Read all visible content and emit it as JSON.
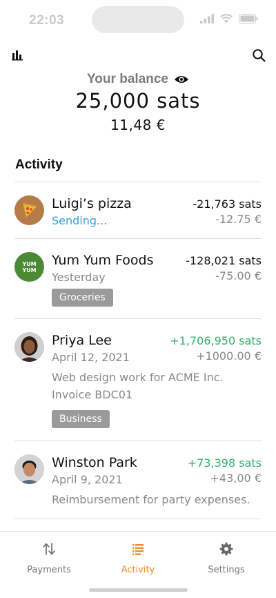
{
  "status_bar": {
    "time": "22:03"
  },
  "balance": {
    "label": "Your balance",
    "sats": "25,000 sats",
    "fiat": "11,48 €"
  },
  "activity": {
    "title": "Activity",
    "items": [
      {
        "name": "Luigi’s pizza",
        "subtitle": "Sending...",
        "sats": "-21,763 sats",
        "fiat": "-12.75 €",
        "avatar_icon": "pizza-icon"
      },
      {
        "name": "Yum Yum Foods",
        "subtitle": "Yesterday",
        "sats": "-128,021 sats",
        "fiat": "-75.00 €",
        "tag": "Groceries",
        "avatar_text": "YUM YUM"
      },
      {
        "name": "Priya Lee",
        "subtitle": "April 12, 2021",
        "sats": "+1,706,950 sats",
        "fiat": "+1000.00 €",
        "note_line1": "Web design work for ACME Inc.",
        "note_line2": "Invoice BDC01",
        "tag": "Business"
      },
      {
        "name": "Winston Park",
        "subtitle": "April 9, 2021",
        "sats": "+73,398 sats",
        "fiat": "+43,00 €",
        "note_line1": "Reimbursement for party expenses."
      }
    ]
  },
  "tabbar": {
    "tabs": [
      {
        "label": "Payments",
        "icon": "transfer-arrows-icon"
      },
      {
        "label": "Activity",
        "icon": "list-icon"
      },
      {
        "label": "Settings",
        "icon": "gear-icon"
      }
    ],
    "active": "Activity"
  },
  "colors": {
    "accent": "#f08a24",
    "positive": "#2fb36a",
    "sending": "#3aa1d6",
    "tag_bg": "#9a9a9a"
  }
}
